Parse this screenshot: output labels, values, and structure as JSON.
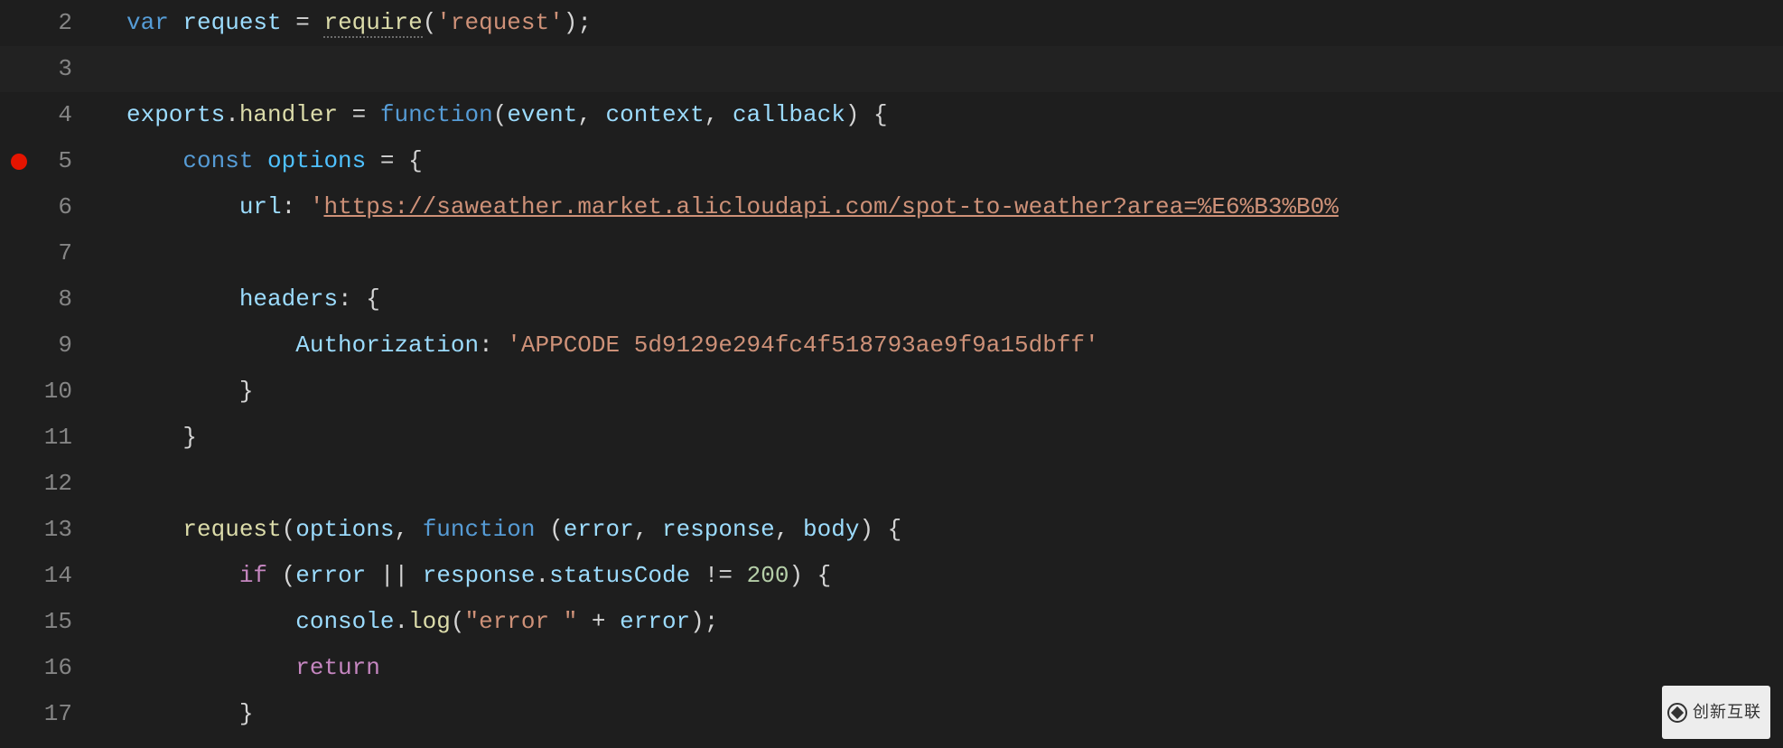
{
  "editor": {
    "theme": "dark",
    "language": "javascript",
    "breakpoint_line": 5,
    "current_line": 3,
    "lines": [
      {
        "n": 2
      },
      {
        "n": 3
      },
      {
        "n": 4
      },
      {
        "n": 5
      },
      {
        "n": 6
      },
      {
        "n": 7
      },
      {
        "n": 8
      },
      {
        "n": 9
      },
      {
        "n": 10
      },
      {
        "n": 11
      },
      {
        "n": 12
      },
      {
        "n": 13
      },
      {
        "n": 14
      },
      {
        "n": 15
      },
      {
        "n": 16
      },
      {
        "n": 17
      }
    ],
    "tokens": {
      "l2": {
        "var": "var",
        "sp1": " ",
        "request": "request",
        "sp2": " ",
        "eq": "=",
        "sp3": " ",
        "require": "require",
        "lp": "(",
        "str": "'request'",
        "rp": ")",
        "semi": ";"
      },
      "l4": {
        "exports": "exports",
        "dot1": ".",
        "handler": "handler",
        "sp1": " ",
        "eq": "=",
        "sp2": " ",
        "function": "function",
        "lp": "(",
        "event": "event",
        "c1": ", ",
        "context": "context",
        "c2": ", ",
        "callback": "callback",
        "rp": ")",
        "sp3": " ",
        "lb": "{"
      },
      "l5": {
        "const": "const",
        "sp1": " ",
        "options": "options",
        "sp2": " ",
        "eq": "=",
        "sp3": " ",
        "lb": "{"
      },
      "l6": {
        "url": "url",
        "colon": ":",
        "sp1": " ",
        "q1": "'",
        "link": "https://saweather.market.alicloudapi.com/spot-to-weather?area=%E6%B3%B0%"
      },
      "l8": {
        "headers": "headers",
        "colon": ":",
        "sp1": " ",
        "lb": "{"
      },
      "l9": {
        "auth": "Authorization",
        "colon": ":",
        "sp1": " ",
        "str": "'APPCODE 5d9129e294fc4f518793ae9f9a15dbff'"
      },
      "l10": {
        "rb": "}"
      },
      "l11": {
        "rb": "}"
      },
      "l13": {
        "request": "request",
        "lp": "(",
        "options": "options",
        "c1": ", ",
        "function": "function",
        "sp1": " ",
        "lp2": "(",
        "error": "error",
        "c2": ", ",
        "response": "response",
        "c3": ", ",
        "body": "body",
        "rp": ")",
        "sp2": " ",
        "lb": "{"
      },
      "l14": {
        "if": "if",
        "sp1": " ",
        "lp": "(",
        "error": "error",
        "sp2": " ",
        "or": "||",
        "sp3": " ",
        "response": "response",
        "dot": ".",
        "statusCode": "statusCode",
        "sp4": " ",
        "neq": "!=",
        "sp5": " ",
        "num": "200",
        "rp": ")",
        "sp6": " ",
        "lb": "{"
      },
      "l15": {
        "console": "console",
        "dot": ".",
        "log": "log",
        "lp": "(",
        "str": "\"error \"",
        "sp1": " ",
        "plus": "+",
        "sp2": " ",
        "error": "error",
        "rp": ")",
        "semi": ";"
      },
      "l16": {
        "return": "return"
      },
      "l17": {
        "rb": "}"
      }
    }
  },
  "watermark": {
    "text": "创新互联"
  }
}
